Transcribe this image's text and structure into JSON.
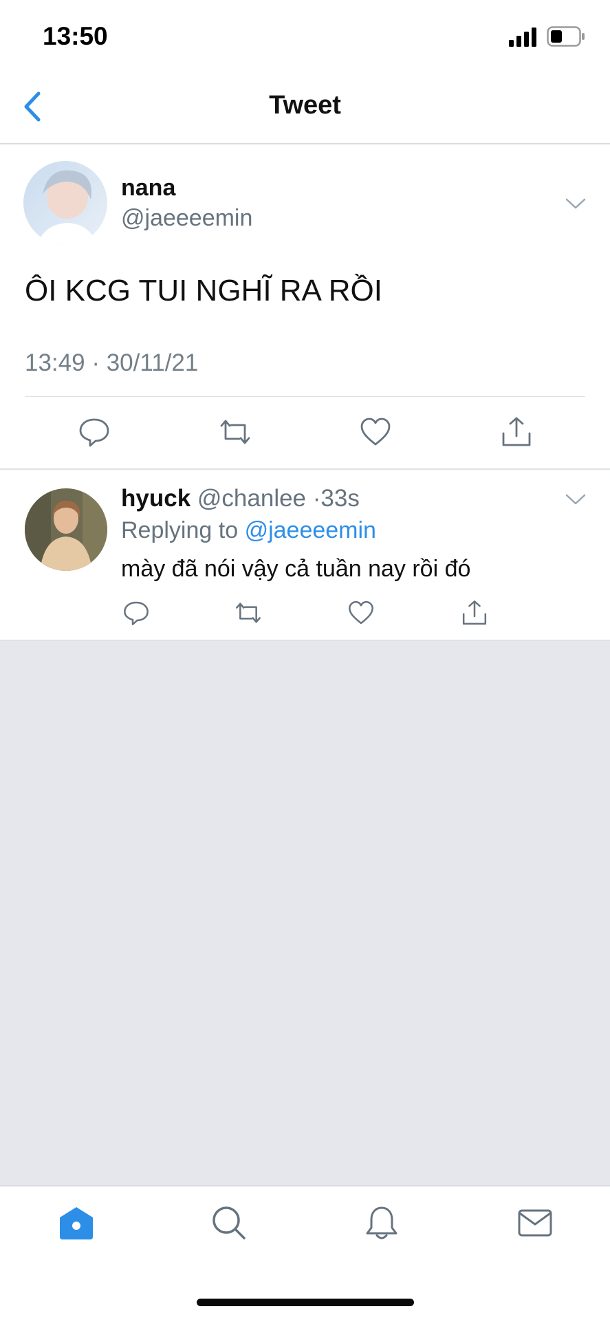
{
  "status_bar": {
    "time": "13:50"
  },
  "nav": {
    "title": "Tweet"
  },
  "main_tweet": {
    "name": "nana",
    "handle": "@jaeeeemin",
    "text": "ÔI KCG TUI NGHĨ RA RỒI",
    "time": "13:49",
    "date": "30/11/21"
  },
  "reply": {
    "name": "hyuck",
    "handle": "@chanlee",
    "age": "33s",
    "replying_label": "Replying to",
    "replying_to": "@jaeeeemin",
    "text": "mày đã nói vậy cả tuần nay rồi đó"
  },
  "colors": {
    "accent": "#2d8ee8",
    "secondary_text": "#66737f",
    "background": "#e6e7ec"
  },
  "icons": {
    "actions": [
      "reply-icon",
      "retweet-icon",
      "like-icon",
      "share-icon"
    ],
    "tabs": [
      "home-icon",
      "search-icon",
      "notifications-icon",
      "messages-icon"
    ]
  }
}
